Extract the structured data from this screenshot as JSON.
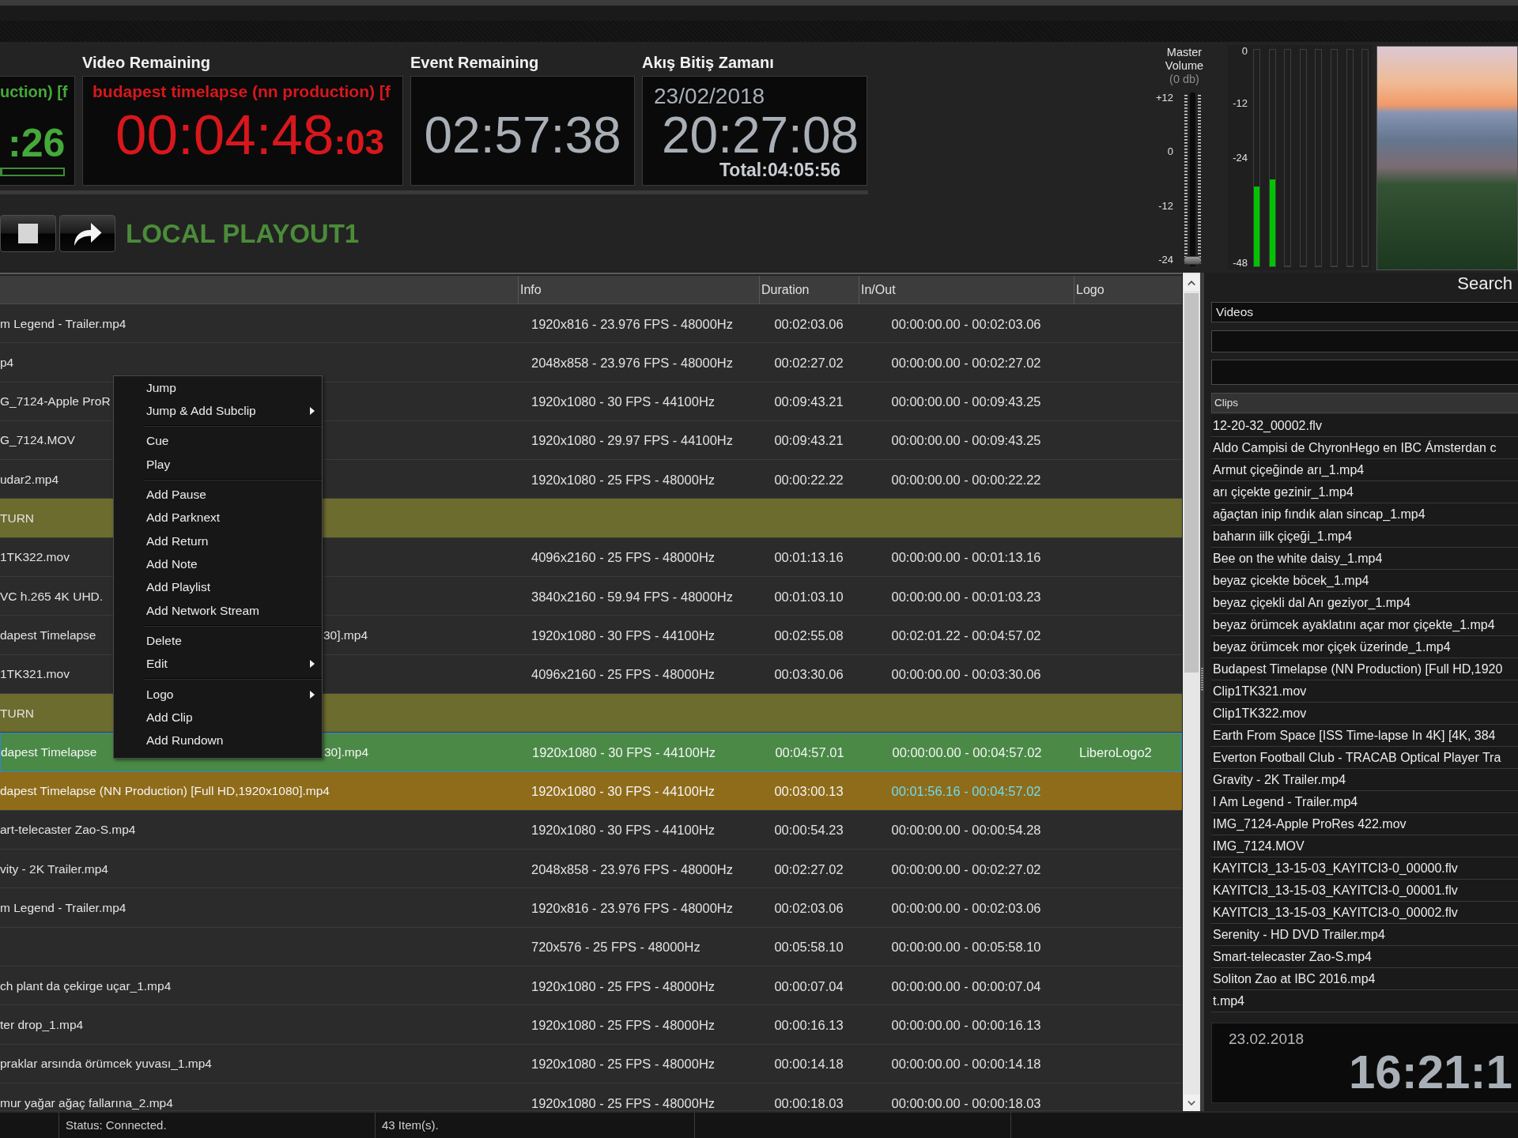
{
  "timers": [
    {
      "kind": "current",
      "title": "uction) [f",
      "time": ":26",
      "level": 0
    },
    {
      "kind": "remaining",
      "label": "Video Remaining",
      "title": "budapest timelapse (nn production) [f",
      "time": "00:04:48",
      "frames": ":03"
    },
    {
      "kind": "event",
      "label": "Event Remaining",
      "time": "02:57:38"
    },
    {
      "kind": "end",
      "label": "Akış Bitiş Zamanı",
      "date": "23/02/2018",
      "time": "20:27:08",
      "total": "Total:04:05:56"
    }
  ],
  "transport": {
    "buttons": [
      {
        "kind": "stop"
      },
      {
        "kind": "redo"
      }
    ],
    "channel": "LOCAL PLAYOUT1"
  },
  "master_volume": {
    "label": "Master Volume",
    "reading": "(0 db)",
    "scale": [
      "+12",
      "0",
      "-12",
      "-24"
    ],
    "level": 0
  },
  "audio_meters": {
    "scale": [
      "0",
      "-12",
      "-24",
      "-48"
    ],
    "channels": [
      {
        "level": 0.37
      },
      {
        "level": 0.4
      },
      {
        "level": 0
      },
      {
        "level": 0
      },
      {
        "level": 0
      },
      {
        "level": 0
      },
      {
        "level": 0
      },
      {
        "level": 0
      }
    ]
  },
  "table": {
    "columns": [
      "Info",
      "Duration",
      "In/Out",
      "Logo"
    ],
    "rows": [
      {
        "kind": "clip",
        "playing": false,
        "cued": false,
        "selected": false,
        "column_1": "m Legend - Trailer.mp4",
        "info": "1920x816 - 23.976 FPS - 48000Hz",
        "duration": "00:02:03.06",
        "in_out": "00:00:00.00 - 00:02:03.06"
      },
      {
        "kind": "clip",
        "playing": false,
        "cued": false,
        "selected": false,
        "column_1": "p4",
        "info": "2048x858 - 23.976 FPS - 48000Hz",
        "duration": "00:02:27.02",
        "in_out": "00:00:00.00 - 00:02:27.02"
      },
      {
        "kind": "clip",
        "playing": false,
        "cued": false,
        "selected": false,
        "column_1": "G_7124-Apple ProR",
        "info": "1920x1080 - 30 FPS - 44100Hz",
        "duration": "00:09:43.21",
        "in_out": "00:00:00.00 - 00:09:43.25"
      },
      {
        "kind": "clip",
        "playing": false,
        "cued": false,
        "selected": false,
        "column_1": "G_7124.MOV",
        "info": "1920x1080 - 29.97 FPS - 44100Hz",
        "duration": "00:09:43.21",
        "in_out": "00:00:00.00 - 00:09:43.25"
      },
      {
        "kind": "clip",
        "playing": false,
        "cued": false,
        "selected": false,
        "column_1": "udar2.mp4",
        "info": "1920x1080 - 25 FPS - 48000Hz",
        "duration": "00:00:22.22",
        "in_out": "00:00:00.00 - 00:00:22.22"
      },
      {
        "kind": "return",
        "selected": false,
        "column_1": "TURN"
      },
      {
        "kind": "clip",
        "playing": false,
        "cued": false,
        "selected": false,
        "column_1": "1TK322.mov",
        "info": "4096x2160 - 25 FPS - 48000Hz",
        "duration": "00:01:13.16",
        "in_out": "00:00:00.00 - 00:01:13.16"
      },
      {
        "kind": "clip",
        "playing": false,
        "cued": false,
        "selected": false,
        "column_1": "VC h.265 4K UHD.",
        "info": "3840x2160 - 59.94 FPS - 48000Hz",
        "duration": "00:01:03.10",
        "in_out": "00:00:00.00 - 00:01:03.23"
      },
      {
        "kind": "clip",
        "playing": false,
        "cued": false,
        "selected": false,
        "column_1": "dapest Timelapse",
        "column_1_after_menu": "30].mp4",
        "info": "1920x1080 - 30 FPS - 44100Hz",
        "duration": "00:02:55.08",
        "in_out": "00:02:01.22 - 00:04:57.02"
      },
      {
        "kind": "clip",
        "playing": false,
        "cued": false,
        "selected": false,
        "column_1": "1TK321.mov",
        "info": "4096x2160 - 25 FPS - 48000Hz",
        "duration": "00:03:30.06",
        "in_out": "00:00:00.00 - 00:03:30.06"
      },
      {
        "kind": "return",
        "selected": false,
        "column_1": "TURN"
      },
      {
        "kind": "clip",
        "playing": true,
        "cued": false,
        "selected": true,
        "column_1": "dapest Timelapse",
        "column_1_after_menu": "30].mp4",
        "info": "1920x1080 - 30 FPS - 44100Hz",
        "duration": "00:04:57.01",
        "in_out": "00:00:00.00 - 00:04:57.02",
        "logo": "LiberoLogo2"
      },
      {
        "kind": "clip",
        "playing": false,
        "cued": true,
        "selected": false,
        "column_1": "dapest Timelapse (NN Production) [Full HD,1920x1080].mp4",
        "info": "1920x1080 - 30 FPS - 44100Hz",
        "duration": "00:03:00.13",
        "in_out": "00:01:56.16 - 00:04:57.02"
      },
      {
        "kind": "clip",
        "playing": false,
        "cued": false,
        "selected": false,
        "column_1": "art-telecaster Zao-S.mp4",
        "info": "1920x1080 - 30 FPS - 44100Hz",
        "duration": "00:00:54.23",
        "in_out": "00:00:00.00 - 00:00:54.28"
      },
      {
        "kind": "clip",
        "playing": false,
        "cued": false,
        "selected": false,
        "column_1": "vity - 2K Trailer.mp4",
        "info": "2048x858 - 23.976 FPS - 48000Hz",
        "duration": "00:02:27.02",
        "in_out": "00:00:00.00 - 00:02:27.02"
      },
      {
        "kind": "clip",
        "playing": false,
        "cued": false,
        "selected": false,
        "column_1": "m Legend - Trailer.mp4",
        "info": "1920x816 - 23.976 FPS - 48000Hz",
        "duration": "00:02:03.06",
        "in_out": "00:00:00.00 - 00:02:03.06"
      },
      {
        "kind": "clip",
        "playing": false,
        "cued": false,
        "selected": false,
        "info": "720x576 - 25 FPS - 48000Hz",
        "duration": "00:05:58.10",
        "in_out": "00:00:00.00 - 00:05:58.10"
      },
      {
        "kind": "clip",
        "playing": false,
        "cued": false,
        "selected": false,
        "column_1": "ch plant da çekirge uçar_1.mp4",
        "info": "1920x1080 - 25 FPS - 48000Hz",
        "duration": "00:00:07.04",
        "in_out": "00:00:00.00 - 00:00:07.04"
      },
      {
        "kind": "clip",
        "playing": false,
        "cued": false,
        "selected": false,
        "column_1": "ter drop_1.mp4",
        "info": "1920x1080 - 25 FPS - 48000Hz",
        "duration": "00:00:16.13",
        "in_out": "00:00:00.00 - 00:00:16.13"
      },
      {
        "kind": "clip",
        "playing": false,
        "cued": false,
        "selected": false,
        "column_1": "praklar arsında örümcek yuvası_1.mp4",
        "info": "1920x1080 - 25 FPS - 48000Hz",
        "duration": "00:00:14.18",
        "in_out": "00:00:00.00 - 00:00:14.18"
      },
      {
        "kind": "clip",
        "playing": false,
        "cued": false,
        "selected": false,
        "column_1": "mur yağar ağaç fallarına_2.mp4",
        "info": "1920x1080 - 25 FPS - 48000Hz",
        "duration": "00:00:18.03",
        "in_out": "00:00:00.00 - 00:00:18.03"
      }
    ]
  },
  "context_menu": {
    "groups": [
      [
        {
          "label": "Jump",
          "submenu": false
        },
        {
          "label": "Jump & Add Subclip",
          "submenu": true
        }
      ],
      [
        {
          "label": "Cue",
          "submenu": false
        },
        {
          "label": "Play",
          "submenu": false
        }
      ],
      [
        {
          "label": "Add Pause",
          "submenu": false
        },
        {
          "label": "Add Parknext",
          "submenu": false
        },
        {
          "label": "Add Return",
          "submenu": false
        },
        {
          "label": "Add Note",
          "submenu": false
        },
        {
          "label": "Add Playlist",
          "submenu": false
        },
        {
          "label": "Add Network Stream",
          "submenu": false
        }
      ],
      [
        {
          "label": "Delete",
          "submenu": false
        },
        {
          "label": "Edit",
          "submenu": true
        }
      ],
      [
        {
          "label": "Logo",
          "submenu": true
        },
        {
          "label": "Add Clip",
          "submenu": false
        },
        {
          "label": "Add Rundown",
          "submenu": false
        }
      ]
    ]
  },
  "library": {
    "title": "Search",
    "category": "Videos",
    "list_header": "Clips",
    "clips": [
      {
        "label": "12-20-32_00002.flv",
        "selected": false
      },
      {
        "label": "Aldo Campisi de ChyronHego en IBC Ámsterdan c",
        "selected": false
      },
      {
        "label": "Armut çiçeğinde arı_1.mp4",
        "selected": false
      },
      {
        "label": "arı çiçekte gezinir_1.mp4",
        "selected": false
      },
      {
        "label": "ağaçtan inip fındık alan sincap_1.mp4",
        "selected": false
      },
      {
        "label": "baharın iilk çiçeği_1.mp4",
        "selected": false
      },
      {
        "label": "Bee on the white daisy_1.mp4",
        "selected": false
      },
      {
        "label": "beyaz çicekte böcek_1.mp4",
        "selected": false
      },
      {
        "label": "beyaz çiçekli dal Arı geziyor_1.mp4",
        "selected": false
      },
      {
        "label": "beyaz örümcek ayaklatını açar mor çiçekte_1.mp4",
        "selected": false
      },
      {
        "label": "beyaz örümcek mor çiçek üzerinde_1.mp4",
        "selected": false
      },
      {
        "label": "Budapest Timelapse (NN Production) [Full HD,1920",
        "selected": false
      },
      {
        "label": "Clip1TK321.mov",
        "selected": false
      },
      {
        "label": "Clip1TK322.mov",
        "selected": false
      },
      {
        "label": "Earth From Space [ISS Time-lapse In 4K] [4K, 384",
        "selected": false
      },
      {
        "label": "Everton Football Club - TRACAB Optical Player Tra",
        "selected": false
      },
      {
        "label": "Gravity - 2K Trailer.mp4",
        "selected": false
      },
      {
        "label": "I Am Legend - Trailer.mp4",
        "selected": false
      },
      {
        "label": "IMG_7124-Apple ProRes 422.mov",
        "selected": false
      },
      {
        "label": "IMG_7124.MOV",
        "selected": false
      },
      {
        "label": "KAYITCI3_13-15-03_KAYITCI3-0_00000.flv",
        "selected": false
      },
      {
        "label": "KAYITCI3_13-15-03_KAYITCI3-0_00001.flv",
        "selected": false
      },
      {
        "label": "KAYITCI3_13-15-03_KAYITCI3-0_00002.flv",
        "selected": false
      },
      {
        "label": "Serenity - HD DVD Trailer.mp4",
        "selected": false
      },
      {
        "label": "Smart-telecaster Zao-S.mp4",
        "selected": false
      },
      {
        "label": "Soliton Zao at IBC 2016.mp4",
        "selected": false
      },
      {
        "label": "t.mp4",
        "selected": false
      }
    ]
  },
  "clock": {
    "date": "23.02.2018",
    "time": "16:21:1"
  },
  "status_bar": [
    "Status: Connected.",
    "43 Item(s)."
  ]
}
